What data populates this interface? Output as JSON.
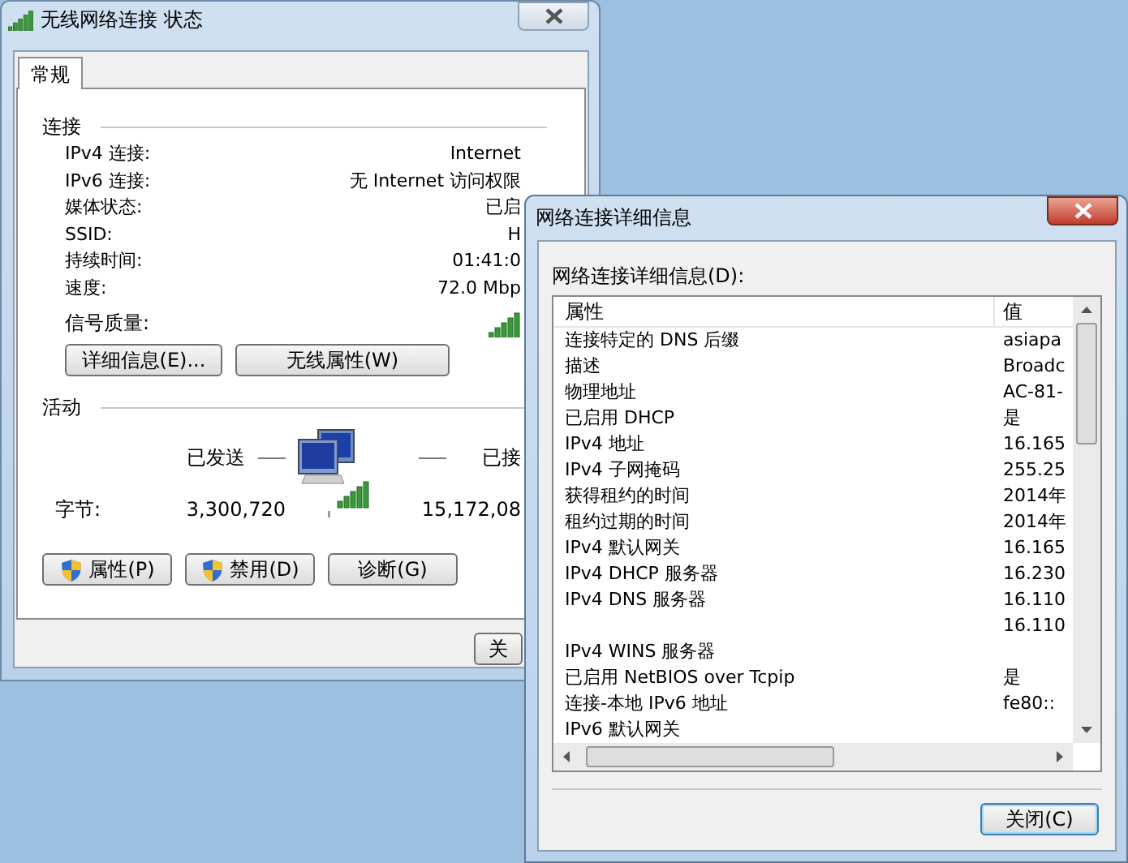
{
  "status_window": {
    "title": "无线网络连接 状态",
    "tabs": [
      {
        "label": "常规",
        "selected": true
      }
    ],
    "connection": {
      "heading": "连接",
      "rows": [
        {
          "label": "IPv4 连接:",
          "value": "Internet"
        },
        {
          "label": "IPv6 连接:",
          "value": "无 Internet 访问权限"
        },
        {
          "label": "媒体状态:",
          "value": "已启"
        },
        {
          "label": "SSID:",
          "value": "H"
        },
        {
          "label": "持续时间:",
          "value": "01:41:0"
        },
        {
          "label": "速度:",
          "value": "72.0 Mbp"
        }
      ]
    },
    "signal_label": "信号质量:",
    "buttons": [
      "详细信息(E)...",
      "无线属性(W)"
    ],
    "activity": {
      "heading": "活动",
      "sent_label": "已发送",
      "received_label": "已接",
      "bytes_label": "字节:",
      "bytes_sent": "3,300,720",
      "bytes_received": "15,172,08"
    },
    "action_buttons": [
      {
        "label": "属性(P)",
        "shield": true
      },
      {
        "label": "禁用(D)",
        "shield": true
      },
      {
        "label": "诊断(G)",
        "shield": false
      }
    ],
    "close_button": "关"
  },
  "details_window": {
    "title": "网络连接详细信息",
    "list_label": "网络连接详细信息(D):",
    "columns": [
      "属性",
      "值"
    ],
    "rows": [
      {
        "property": "连接特定的 DNS 后缀",
        "value": "asiapa"
      },
      {
        "property": "描述",
        "value": "Broadc"
      },
      {
        "property": "物理地址",
        "value": "AC-81-"
      },
      {
        "property": "已启用 DHCP",
        "value": "是"
      },
      {
        "property": "IPv4 地址",
        "value": "16.165"
      },
      {
        "property": "IPv4 子网掩码",
        "value": "255.25"
      },
      {
        "property": "获得租约的时间",
        "value": "2014年"
      },
      {
        "property": "租约过期的时间",
        "value": "2014年"
      },
      {
        "property": "IPv4 默认网关",
        "value": "16.165"
      },
      {
        "property": "IPv4 DHCP 服务器",
        "value": "16.230"
      },
      {
        "property": "IPv4 DNS 服务器",
        "value": "16.110"
      },
      {
        "value": "16.110"
      },
      {
        "property": "IPv4 WINS 服务器"
      },
      {
        "property": "已启用 NetBIOS over Tcpip",
        "value": "是"
      },
      {
        "property": "连接-本地 IPv6 地址",
        "value": "fe80::"
      },
      {
        "property": "IPv6 默认网关"
      }
    ],
    "close_button": "关闭(C)"
  }
}
